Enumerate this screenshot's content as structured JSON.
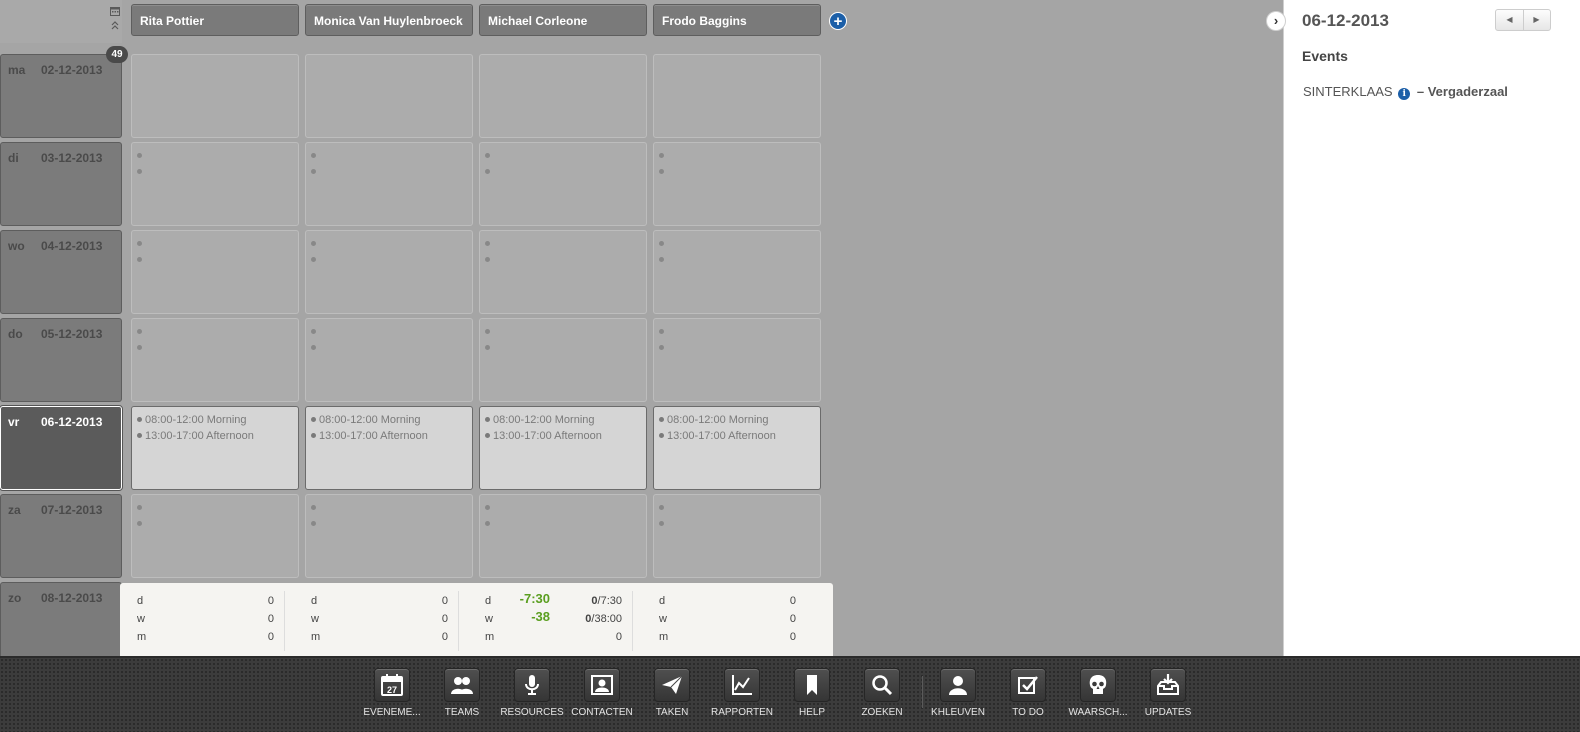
{
  "week": {
    "number": "49"
  },
  "people": [
    {
      "name": "Rita Pottier"
    },
    {
      "name": "Monica Van Huylenbroeck"
    },
    {
      "name": "Michael Corleone"
    },
    {
      "name": "Frodo Baggins"
    }
  ],
  "days": [
    {
      "day": "ma",
      "date": "02-12-2013"
    },
    {
      "day": "di",
      "date": "03-12-2013"
    },
    {
      "day": "wo",
      "date": "04-12-2013"
    },
    {
      "day": "do",
      "date": "05-12-2013"
    },
    {
      "day": "vr",
      "date": "06-12-2013"
    },
    {
      "day": "za",
      "date": "07-12-2013"
    },
    {
      "day": "zo",
      "date": "08-12-2013"
    }
  ],
  "shifts": {
    "morning": "08:00-12:00 Morning",
    "afternoon": "13:00-17:00 Afternoon"
  },
  "totals": [
    {
      "rows": [
        {
          "k": "d",
          "v": "0"
        },
        {
          "k": "w",
          "v": "0"
        },
        {
          "k": "m",
          "v": "0"
        }
      ]
    },
    {
      "rows": [
        {
          "k": "d",
          "v": "0"
        },
        {
          "k": "w",
          "v": "0"
        },
        {
          "k": "m",
          "v": "0"
        }
      ]
    },
    {
      "rows": [
        {
          "k": "d",
          "big": "-7:30",
          "v_bold": "0",
          "v_rest": "/7:30"
        },
        {
          "k": "w",
          "big": "-38",
          "v_bold": "0",
          "v_rest": "/38:00"
        },
        {
          "k": "m",
          "v": "0"
        }
      ]
    },
    {
      "rows": [
        {
          "k": "d",
          "v": "0"
        },
        {
          "k": "w",
          "v": "0"
        },
        {
          "k": "m",
          "v": "0"
        }
      ]
    }
  ],
  "panel": {
    "date": "06-12-2013",
    "events_heading": "Events",
    "event": {
      "name": "SINTERKLAAS",
      "info": "i",
      "separator": "–",
      "location": "Vergaderzaal"
    },
    "collapse_icon": "›",
    "prev_icon": "◀",
    "next_icon": "▶"
  },
  "dock": [
    {
      "label": "EVENEME...",
      "icon": "calendar-icon",
      "day": "27"
    },
    {
      "label": "TEAMS",
      "icon": "team-icon"
    },
    {
      "label": "RESOURCES",
      "icon": "microphone-icon"
    },
    {
      "label": "CONTACTEN",
      "icon": "contact-card-icon"
    },
    {
      "label": "TAKEN",
      "icon": "paper-plane-icon"
    },
    {
      "label": "RAPPORTEN",
      "icon": "line-chart-icon"
    },
    {
      "label": "HELP",
      "icon": "bookmark-icon"
    },
    {
      "label": "ZOEKEN",
      "icon": "search-icon"
    },
    {
      "label": "KHLEUVEN",
      "icon": "user-icon"
    },
    {
      "label": "TO DO",
      "icon": "checkbox-icon"
    },
    {
      "label": "WAARSCH...",
      "icon": "skull-icon"
    },
    {
      "label": "UPDATES",
      "icon": "inbox-download-icon"
    }
  ]
}
